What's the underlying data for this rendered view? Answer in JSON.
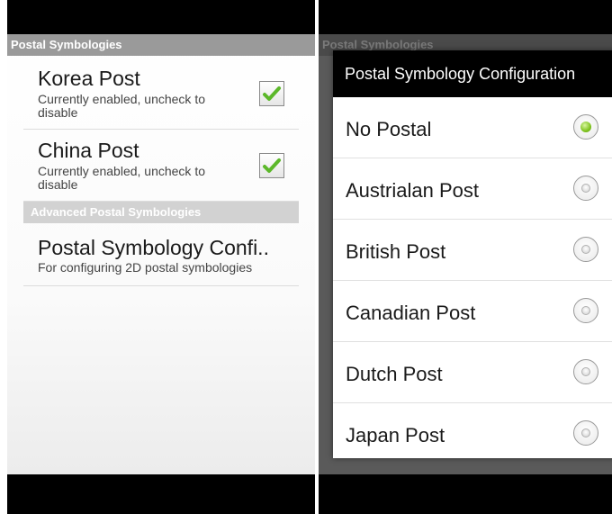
{
  "left": {
    "category_header": "Postal Symbologies",
    "prefs": [
      {
        "title": "Korea Post",
        "summary": "Currently enabled, uncheck to disable",
        "checked": true
      },
      {
        "title": "China Post",
        "summary": "Currently enabled, uncheck to disable",
        "checked": true
      }
    ],
    "advanced_header": "Advanced Postal Symbologies",
    "config": {
      "title": "Postal Symbology Confi..",
      "summary": "For configuring 2D postal symbologies"
    }
  },
  "right": {
    "dimmed_header": "Postal Symbologies",
    "dialog": {
      "title": "Postal Symbology Configuration",
      "options": [
        {
          "label": "No Postal",
          "selected": true
        },
        {
          "label": "Austrialan Post",
          "selected": false
        },
        {
          "label": "British Post",
          "selected": false
        },
        {
          "label": "Canadian Post",
          "selected": false
        },
        {
          "label": "Dutch Post",
          "selected": false
        },
        {
          "label": "Japan Post",
          "selected": false
        }
      ]
    }
  },
  "colors": {
    "checkmark": "#5cb82a",
    "radio_selected": "#7fc31f",
    "category_bg": "#9a9a9a"
  },
  "icons": {
    "checkbox": "checkmark-icon",
    "radio": "radio-button-icon"
  }
}
